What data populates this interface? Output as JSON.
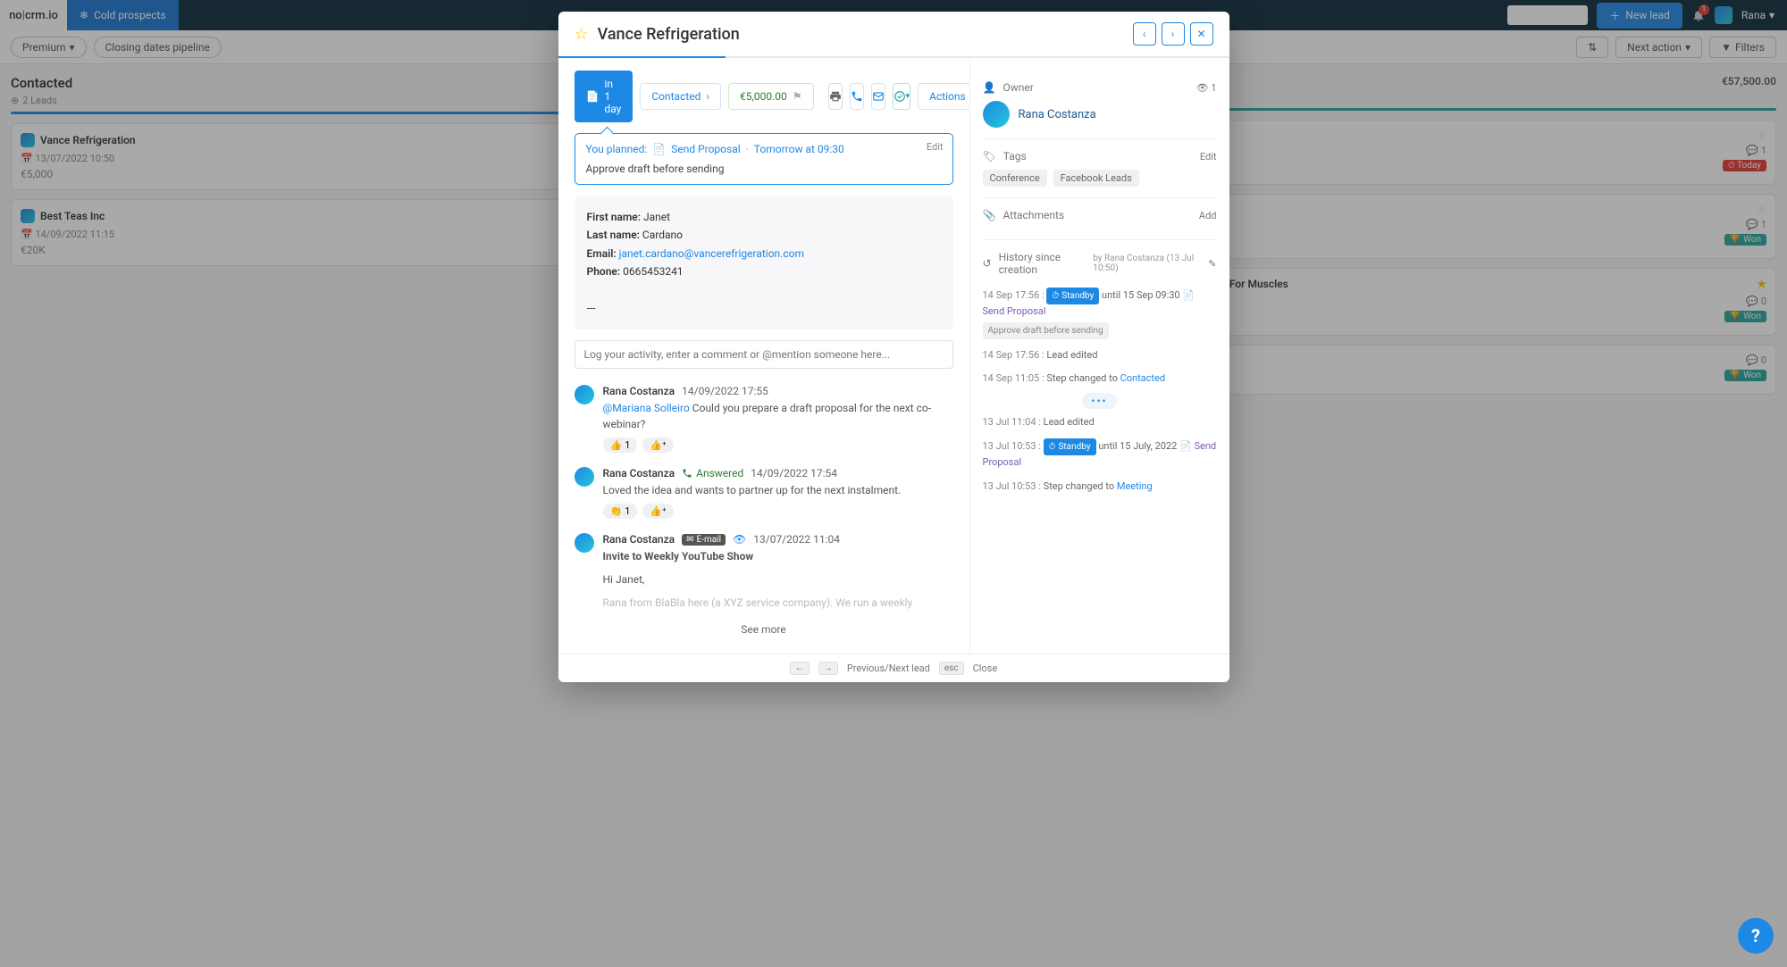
{
  "topbar": {
    "logo_pre": "no",
    "logo_mid": "|",
    "logo_post": "crm.io",
    "tab_cold": "Cold prospects",
    "new_lead": "New lead",
    "notif_count": "1",
    "user": "Rana"
  },
  "filters": {
    "premium": "Premium",
    "pipeline": "Closing dates pipeline",
    "next_action": "Next action",
    "filters": "Filters"
  },
  "board": {
    "col1": {
      "title": "Contacted",
      "leads": "2 Leads"
    },
    "col1_cards": [
      {
        "title": "Vance Refrigeration",
        "date": "13/07/2022 10:50",
        "amount": "€5,000"
      },
      {
        "title": "Best Teas Inc",
        "date": "14/09/2022 11:15",
        "amount": "€20K"
      }
    ],
    "col3_total": "€57,500.00",
    "col3_cards": [
      {
        "comments": "1",
        "badge": "Today"
      },
      {
        "comments": "1",
        "badge": "Won"
      },
      {
        "title": "Gym For Muscles",
        "comments": "0",
        "badge": "Won"
      },
      {
        "comments": "0",
        "badge": "Won"
      }
    ]
  },
  "modal": {
    "title": "Vance Refrigeration",
    "chip_due": "in 1 day",
    "chip_status": "Contacted",
    "chip_amount": "€5,000.00",
    "actions": "Actions",
    "planned": {
      "label": "You planned:",
      "activity": "Send Proposal",
      "when": "Tomorrow at 09:30",
      "edit": "Edit",
      "note": "Approve draft before sending"
    },
    "contact": {
      "fn_l": "First name:",
      "fn": "Janet",
      "ln_l": "Last name:",
      "ln": "Cardano",
      "em_l": "Email:",
      "em": "janet.cardano@vancerefrigeration.com",
      "ph_l": "Phone:",
      "ph": "0665453241",
      "sep": "---"
    },
    "log_placeholder": "Log your activity, enter a comment or @mention someone here...",
    "feed": [
      {
        "name": "Rana Costanza",
        "date": "14/09/2022 17:55",
        "mention": "@Mariana Solleiro",
        "text": " Could you prepare a draft proposal for the next co-webinar?",
        "r1": "👍",
        "r1c": "1",
        "r2": "👍⁺"
      },
      {
        "name": "Rana Costanza",
        "answered": "Answered",
        "date": "14/09/2022 17:54",
        "text": "Loved the idea and wants to partner up for the next instalment.",
        "r1": "👏",
        "r1c": "1",
        "r2": "👍⁺"
      },
      {
        "name": "Rana Costanza",
        "email": "E-mail",
        "date": "13/07/2022 11:04",
        "subject": "Invite to Weekly YouTube Show",
        "greet": "Hi Janet,",
        "body": "Rana from BlaBla here (a XYZ service company). We run a weekly"
      }
    ],
    "seemore": "See more",
    "owner": {
      "label": "Owner",
      "count": "1",
      "name": "Rana Costanza"
    },
    "tags": {
      "label": "Tags",
      "edit": "Edit",
      "items": [
        "Conference",
        "Facebook Leads"
      ]
    },
    "attach": {
      "label": "Attachments",
      "add": "Add"
    },
    "history": {
      "label": "History since creation",
      "by": "by Rana Costanza",
      "ts": "(13 Jul 10:50)",
      "items": [
        {
          "t": "14 Sep 17:56 :",
          "standby": "Standby",
          "until": "until 15 Sep 09:30",
          "link": "Send Proposal",
          "note": "Approve draft before sending"
        },
        {
          "t": "14 Sep 17:56 :",
          "text": "Lead edited"
        },
        {
          "t": "14 Sep 11:05 :",
          "text": "Step changed to ",
          "link2": "Contacted"
        },
        {
          "more": "•••"
        },
        {
          "t": "13 Jul 11:04 :",
          "text": "Lead edited"
        },
        {
          "t": "13 Jul 10:53 :",
          "standby": "Standby",
          "until": "until 15 July, 2022",
          "link": "Send Proposal"
        },
        {
          "t": "13 Jul 10:53 :",
          "text": "Step changed to ",
          "link2": "Meeting"
        }
      ]
    },
    "footer": {
      "prevnext": "Previous/Next lead",
      "close": "Close",
      "esc": "esc"
    }
  }
}
